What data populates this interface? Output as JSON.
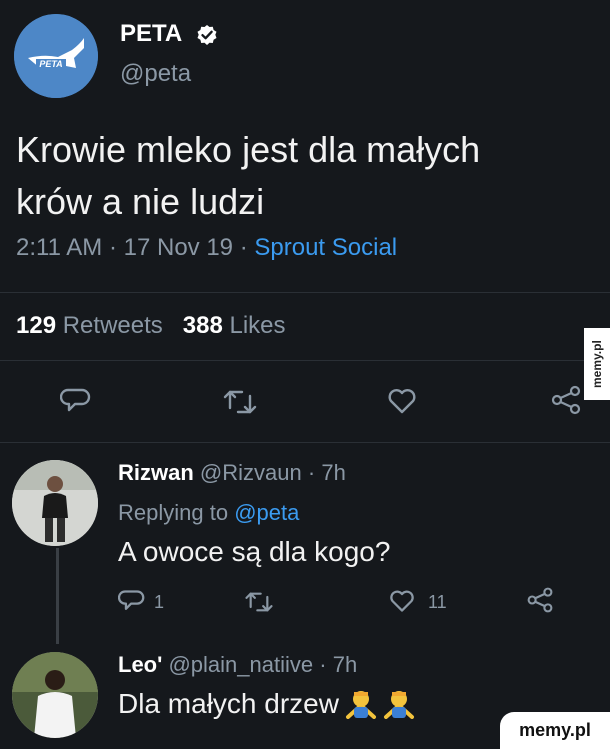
{
  "tweet": {
    "author_name": "PETA",
    "author_handle": "@peta",
    "avatar_text": "PETA",
    "text_line1": "Krowie mleko jest dla małych",
    "text_line2": "krów a nie ludzi",
    "time": "2:11 AM",
    "date": "17 Nov 19",
    "source": "Sprout Social",
    "retweets_count": "129",
    "retweets_label": "Retweets",
    "likes_count": "388",
    "likes_label": "Likes"
  },
  "replies": [
    {
      "name": "Rizwan",
      "handle": "@Rizvaun",
      "age": "7h",
      "replying_label": "Replying to",
      "replying_to": "@peta",
      "text": "A owoce są dla kogo?",
      "reply_count": "1",
      "like_count": "11"
    },
    {
      "name": "Leo'",
      "handle": "@plain_natiive",
      "age": "7h",
      "text": "Dla małych drzew"
    }
  ],
  "watermark": {
    "side": "memy.pl",
    "corner": "memy.pl"
  },
  "colors": {
    "background": "#15181c",
    "link": "#3b9bf0",
    "muted": "#8b98a5",
    "avatar": "#4d87c7"
  }
}
